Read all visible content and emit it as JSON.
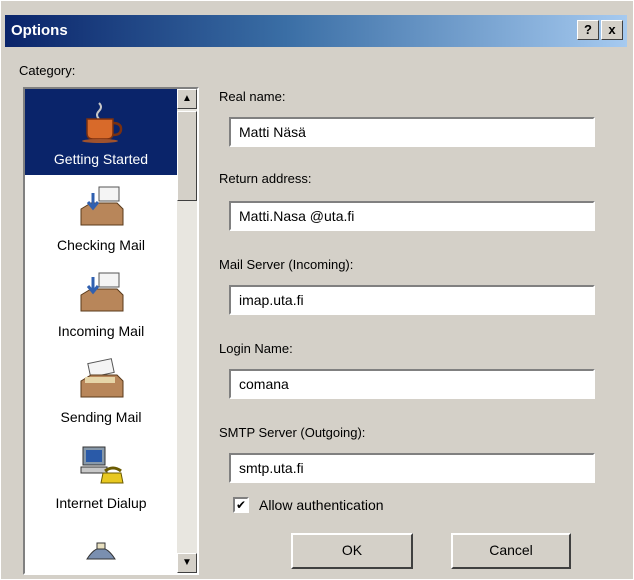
{
  "window": {
    "title": "Options",
    "help_label": "?",
    "close_label": "x"
  },
  "category": {
    "label": "Category:",
    "items": [
      {
        "label": "Getting Started",
        "icon": "coffee-cup-icon",
        "selected": true
      },
      {
        "label": "Checking Mail",
        "icon": "inbox-tray-icon",
        "selected": false
      },
      {
        "label": "Incoming Mail",
        "icon": "incoming-mail-icon",
        "selected": false
      },
      {
        "label": "Sending Mail",
        "icon": "outbox-tray-icon",
        "selected": false
      },
      {
        "label": "Internet Dialup",
        "icon": "computer-phone-icon",
        "selected": false
      }
    ],
    "scroll_up": "▲",
    "scroll_down": "▼"
  },
  "form": {
    "real_name_label": "Real name:",
    "real_name_value": "Matti Näsä",
    "return_address_label": "Return address:",
    "return_address_value": "Matti.Nasa @uta.fi",
    "mail_server_label": "Mail Server (Incoming):",
    "mail_server_value": "imap.uta.fi",
    "login_name_label": "Login Name:",
    "login_name_value": "comana",
    "smtp_server_label": "SMTP Server (Outgoing):",
    "smtp_server_value": "smtp.uta.fi",
    "allow_auth_label": "Allow authentication",
    "allow_auth_checked": "✔"
  },
  "buttons": {
    "ok": "OK",
    "cancel": "Cancel"
  }
}
